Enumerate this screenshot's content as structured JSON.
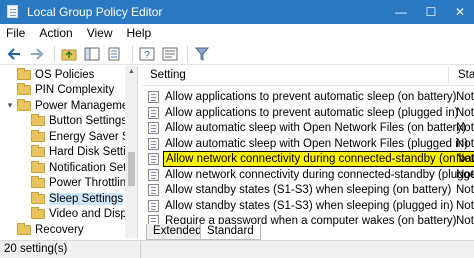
{
  "window": {
    "title": "Local Group Policy Editor",
    "minimize_glyph": "—",
    "maximize_glyph": "☐",
    "close_glyph": "✕"
  },
  "menu": [
    "File",
    "Action",
    "View",
    "Help"
  ],
  "toolbar": {
    "icons": [
      "back-arrow-icon",
      "forward-arrow-icon",
      "up-folder-icon",
      "show-hide-tree-icon",
      "export-list-icon",
      "help-icon",
      "properties-icon",
      "filter-icon"
    ]
  },
  "tree": {
    "items": [
      {
        "label": "OS Policies",
        "level": 1,
        "expander": "",
        "selected": false
      },
      {
        "label": "PIN Complexity",
        "level": 1,
        "expander": "",
        "selected": false
      },
      {
        "label": "Power Management",
        "level": 1,
        "expander": "▾",
        "selected": false
      },
      {
        "label": "Button Settings",
        "level": 2,
        "expander": "",
        "selected": false
      },
      {
        "label": "Energy Saver Settings",
        "level": 2,
        "expander": "",
        "selected": false
      },
      {
        "label": "Hard Disk Settings",
        "level": 2,
        "expander": "",
        "selected": false
      },
      {
        "label": "Notification Settings",
        "level": 2,
        "expander": "",
        "selected": false
      },
      {
        "label": "Power Throttling Settings",
        "level": 2,
        "expander": "",
        "selected": false
      },
      {
        "label": "Sleep Settings",
        "level": 2,
        "expander": "",
        "selected": true
      },
      {
        "label": "Video and Display",
        "level": 2,
        "expander": "",
        "selected": false
      },
      {
        "label": "Recovery",
        "level": 1,
        "expander": "",
        "selected": false
      }
    ]
  },
  "list": {
    "headers": {
      "setting": "Setting",
      "state": "Stat"
    },
    "rows": [
      {
        "setting": "Allow applications to prevent automatic sleep (on battery)",
        "state": "Not",
        "highlight": false
      },
      {
        "setting": "Allow applications to prevent automatic sleep (plugged in)",
        "state": "Not",
        "highlight": false
      },
      {
        "setting": "Allow automatic sleep with Open Network Files (on battery)",
        "state": "Not",
        "highlight": false
      },
      {
        "setting": "Allow automatic sleep with Open Network Files (plugged in)",
        "state": "Not",
        "highlight": false
      },
      {
        "setting": "Allow network connectivity during connected-standby (on battery)",
        "state": "Not",
        "highlight": true
      },
      {
        "setting": "Allow network connectivity during connected-standby (plugged in)",
        "state": "Not",
        "highlight": false
      },
      {
        "setting": "Allow standby states (S1-S3) when sleeping (on battery)",
        "state": "Not",
        "highlight": false
      },
      {
        "setting": "Allow standby states (S1-S3) when sleeping (plugged in)",
        "state": "Not",
        "highlight": false
      },
      {
        "setting": "Require a password when a computer wakes (on battery)",
        "state": "Not",
        "highlight": false
      }
    ]
  },
  "tabs": [
    "Extended",
    "Standard"
  ],
  "active_tab": "Standard",
  "status": {
    "text": "20 setting(s)"
  },
  "colors": {
    "titlebar": "#2b78c3",
    "highlight": "#fff200",
    "selection": "#cce8ff"
  }
}
